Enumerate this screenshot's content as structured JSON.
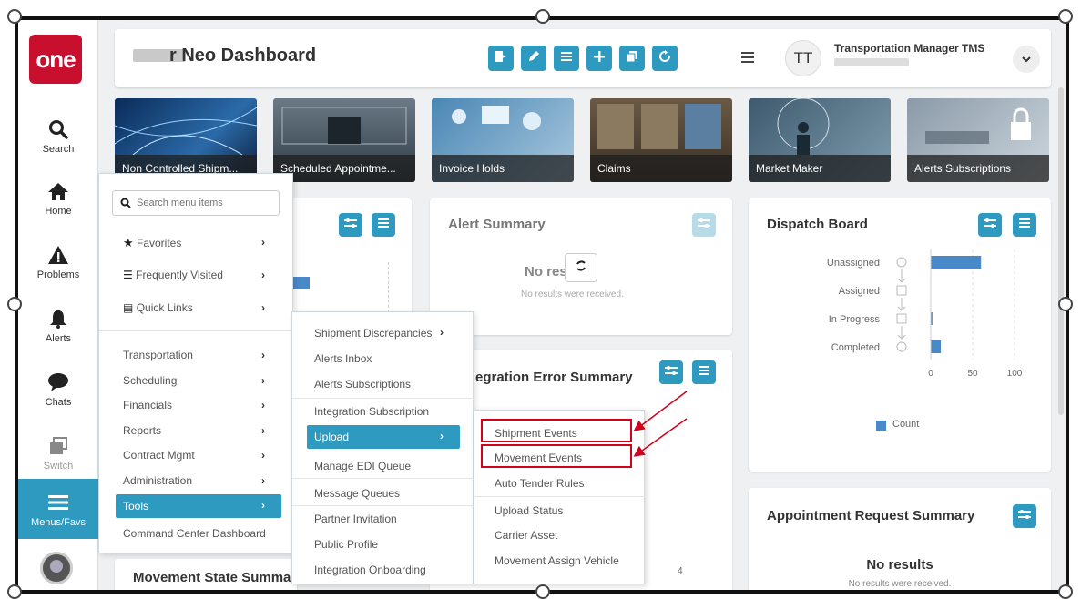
{
  "header": {
    "title": "r Neo Dashboard",
    "user_initials": "TT",
    "user_name": "Transportation Manager TMS"
  },
  "leftnav": {
    "logo": "one",
    "items": [
      {
        "label": "Search",
        "icon": "search-icon"
      },
      {
        "label": "Home",
        "icon": "home-icon"
      },
      {
        "label": "Problems",
        "icon": "warning-icon"
      },
      {
        "label": "Alerts",
        "icon": "bell-icon"
      },
      {
        "label": "Chats",
        "icon": "chat-icon"
      },
      {
        "label": "Switch",
        "icon": "switch-icon"
      },
      {
        "label": "Menus/Favs",
        "icon": "menu-icon"
      }
    ]
  },
  "tiles": [
    "Non Controlled Shipm...",
    "Scheduled Appointme...",
    "Invoice Holds",
    "Claims",
    "Market Maker",
    "Alerts Subscriptions"
  ],
  "alert_summary": {
    "title": "Alert Summary",
    "no_results": "No results",
    "sub": "No results were received."
  },
  "dispatch_board": {
    "title": "Dispatch Board",
    "legend": "Count"
  },
  "integration_error": {
    "title": "egration Error Summary",
    "axis_tick": "4"
  },
  "appointment": {
    "title": "Appointment Request Summary",
    "no_results": "No results",
    "sub": "No results were received."
  },
  "movement_state": {
    "title": "Movement State Summa"
  },
  "menu1": {
    "search_placeholder": "Search menu items",
    "top": [
      {
        "label": "Favorites",
        "icon": "star-icon"
      },
      {
        "label": "Frequently Visited",
        "icon": "list-icon"
      },
      {
        "label": "Quick Links",
        "icon": "link-box-icon"
      }
    ],
    "items": [
      "Transportation",
      "Scheduling",
      "Financials",
      "Reports",
      "Contract Mgmt",
      "Administration",
      "Tools",
      "Command Center Dashboard"
    ]
  },
  "menu2": {
    "items": [
      "Shipment Discrepancies",
      "Alerts Inbox",
      "Alerts Subscriptions",
      "Integration Subscription",
      "Upload",
      "Manage EDI Queue",
      "Message Queues",
      "Partner Invitation",
      "Public Profile",
      "Integration Onboarding"
    ]
  },
  "menu3": {
    "items": [
      "Shipment Events",
      "Movement Events",
      "Auto Tender Rules",
      "Upload Status",
      "Carrier Asset",
      "Movement Assign Vehicle"
    ]
  },
  "chart_data": {
    "type": "bar",
    "categories": [
      "Unassigned",
      "Assigned",
      "In Progress",
      "Completed"
    ],
    "series": [
      {
        "name": "Count",
        "values": [
          60,
          0,
          2,
          12
        ]
      }
    ],
    "xlim": [
      0,
      100
    ],
    "xticks": [
      "0",
      "50",
      "100"
    ],
    "colors": {
      "bar": "#4a89c8"
    }
  },
  "colors": {
    "accent": "#2e9ac0",
    "logo": "#c8102e",
    "highlight": "#d0021b"
  }
}
